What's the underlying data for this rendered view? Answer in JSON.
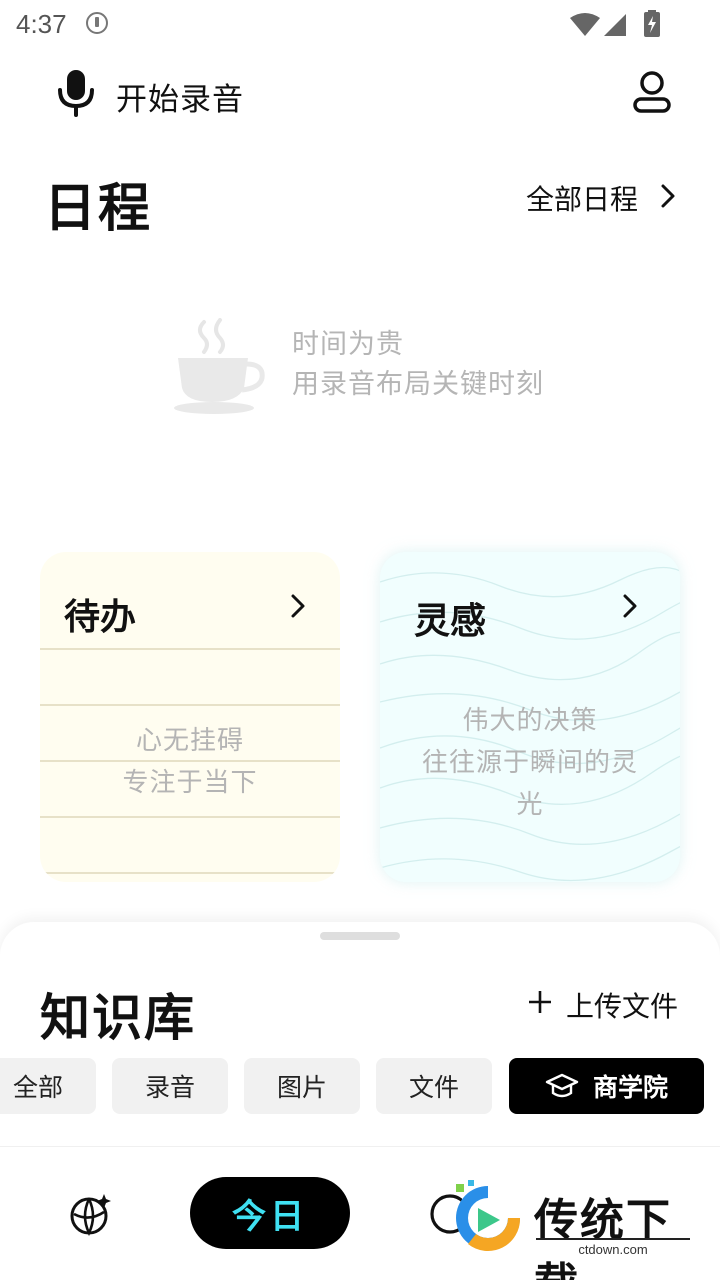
{
  "status_bar": {
    "time": "4:37"
  },
  "header": {
    "record_label": "开始录音"
  },
  "schedule": {
    "title": "日程",
    "all_link": "全部日程",
    "empty_lines": [
      "时间为贵",
      "用录音布局关键时刻"
    ]
  },
  "todo": {
    "title": "待办",
    "empty_lines": [
      "心无挂碍",
      "专注于当下"
    ]
  },
  "ideas": {
    "title": "灵感",
    "empty_lines": [
      "伟大的决策",
      "往往源于瞬间的灵",
      "光"
    ]
  },
  "knowledge": {
    "title": "知识库",
    "upload_label": "上传文件",
    "filters": [
      "全部",
      "录音",
      "图片",
      "文件"
    ],
    "active_filter": "商学院"
  },
  "bottom_nav": {
    "today_label": "今日"
  },
  "watermark": {
    "brand": "传统下载",
    "url": "ctdown.com"
  },
  "colors": {
    "accent_cyan": "#3fe0f2",
    "todo_card_bg": "#fffdf0",
    "idea_card_bg": "#f1fefe"
  },
  "icons": [
    "microphone-icon",
    "user-icon",
    "chevron-right-icon",
    "teacup-icon",
    "plus-icon",
    "graduation-cap-icon",
    "discover-icon"
  ]
}
